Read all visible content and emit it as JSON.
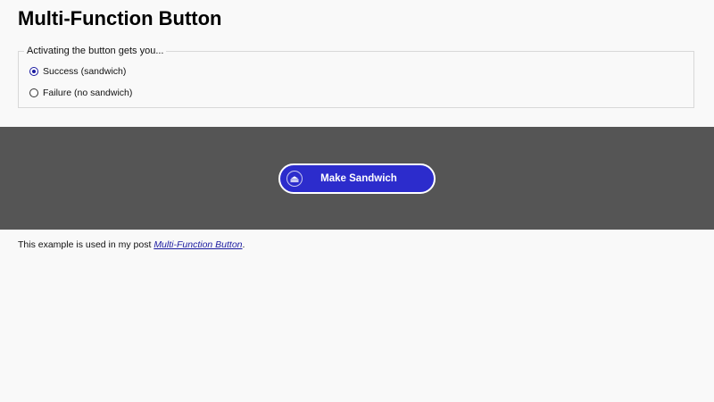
{
  "page": {
    "title": "Multi-Function Button"
  },
  "options_group": {
    "legend": "Activating the button gets you...",
    "options": [
      {
        "label": "Success (sandwich)",
        "checked": true
      },
      {
        "label": "Failure (no sandwich)",
        "checked": false
      }
    ]
  },
  "action": {
    "button_label": "Make Sandwich",
    "icon": "sandwich-icon",
    "colors": {
      "band": "#555555",
      "button": "#2c2ccc",
      "border": "#ffffff"
    }
  },
  "footer": {
    "prefix": "This example is used in my post ",
    "link_text": "Multi-Function Button",
    "suffix": "."
  }
}
